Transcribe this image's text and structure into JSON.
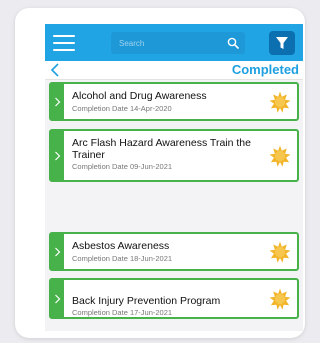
{
  "header": {
    "search_placeholder": "Search",
    "subtitle": "Completed"
  },
  "icons": {
    "menu": "hamburger-icon",
    "search": "search-icon",
    "filter": "filter-icon",
    "back": "chevron-left-icon",
    "expand": "chevron-right-icon",
    "badge": "sun-badge-icon"
  },
  "colors": {
    "header_bg": "#20a4e4",
    "accent": "#1ea0e0",
    "item_border": "#47b14a",
    "badge": "#f2b52a"
  },
  "items": [
    {
      "title": "Alcohol and Drug Awareness",
      "date": "Completion Date 14-Apr-2020"
    },
    {
      "title": "Arc Flash Hazard Awareness Train the Trainer",
      "date": "Completion Date 09-Jun-2021"
    },
    {
      "title": "Asbestos Awareness",
      "date": "Completion Date 18-Jun-2021"
    },
    {
      "title": "Back Injury Prevention Program",
      "date": "Completion Date 17-Jun-2021"
    }
  ]
}
